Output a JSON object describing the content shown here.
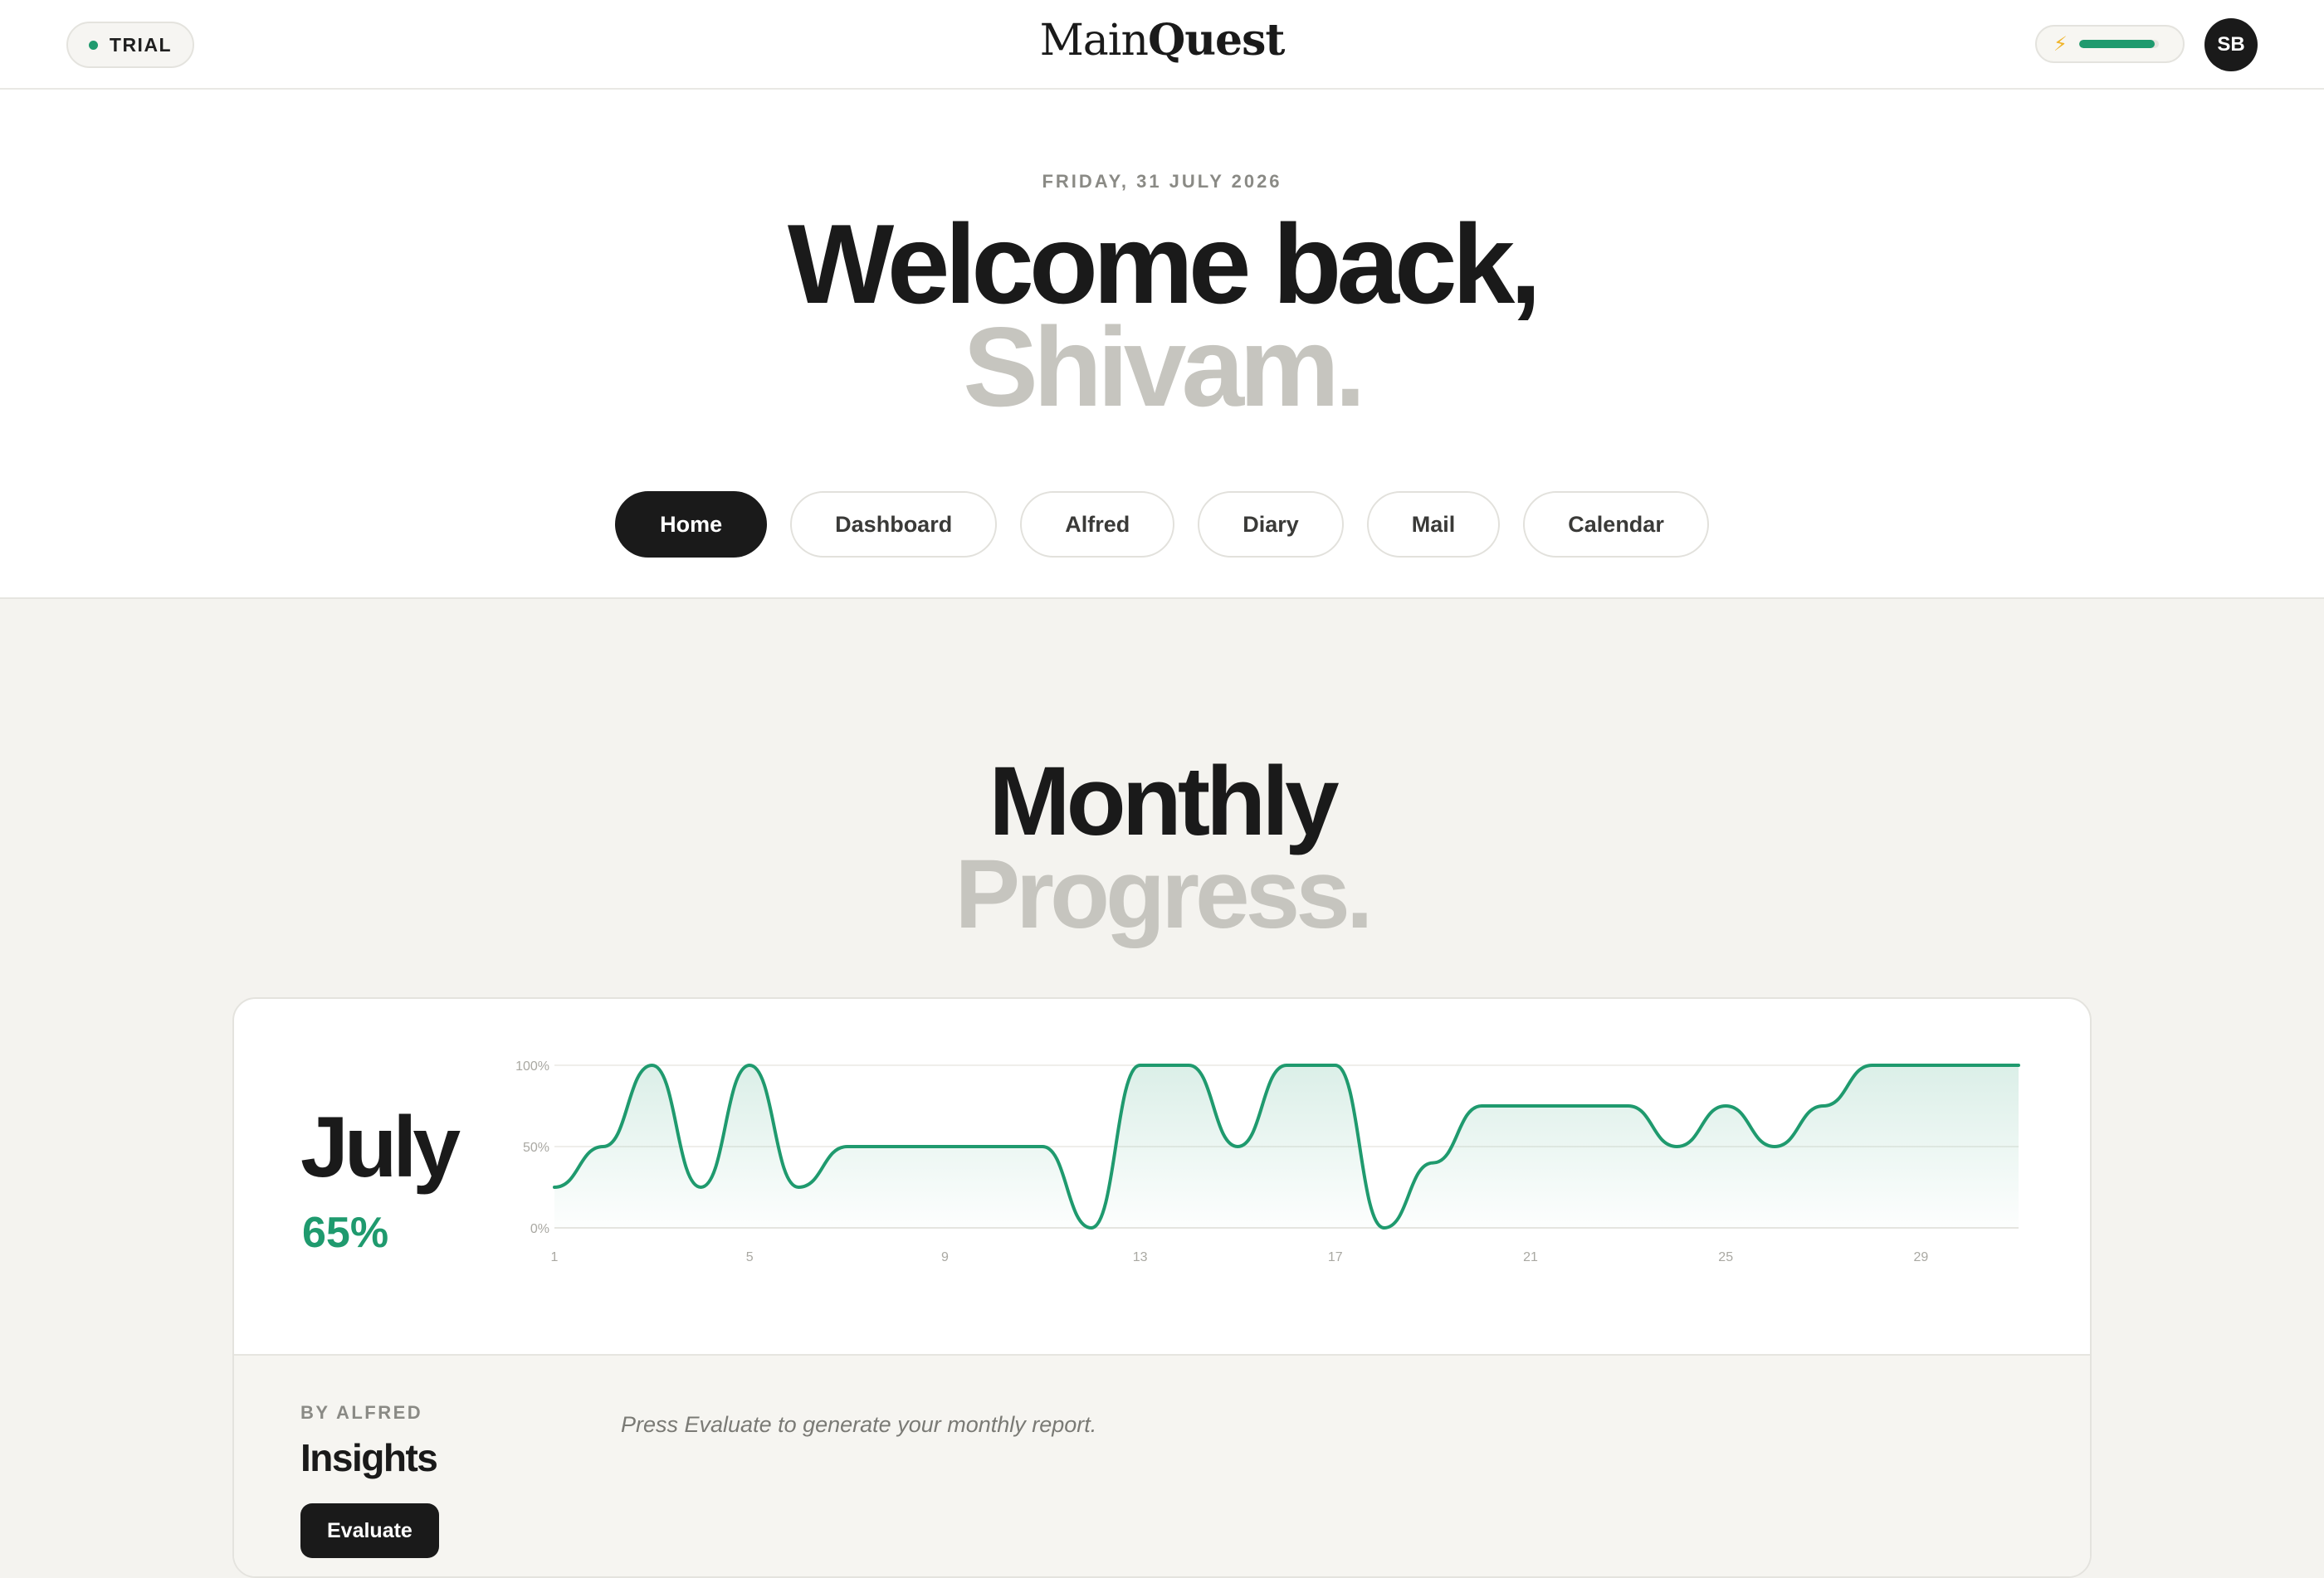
{
  "header": {
    "trial_label": "TRIAL",
    "brand_part1": "Main",
    "brand_part2": "Quest",
    "energy_icon": "bolt-icon",
    "energy_level": 0.95,
    "avatar_initials": "SB"
  },
  "hero": {
    "date": "FRIDAY, 31 JULY 2026",
    "welcome_line1": "Welcome back,",
    "welcome_line2": "Shivam."
  },
  "nav": {
    "items": [
      {
        "label": "Home",
        "active": true
      },
      {
        "label": "Dashboard",
        "active": false
      },
      {
        "label": "Alfred",
        "active": false
      },
      {
        "label": "Diary",
        "active": false
      },
      {
        "label": "Mail",
        "active": false
      },
      {
        "label": "Calendar",
        "active": false
      }
    ]
  },
  "section": {
    "title_line1": "Monthly",
    "title_line2": "Progress."
  },
  "progress_card": {
    "month": "July",
    "percent": "65%"
  },
  "insights": {
    "byline": "BY ALFRED",
    "title": "Insights",
    "evaluate_label": "Evaluate",
    "hint": "Press Evaluate to generate your monthly report."
  },
  "colors": {
    "accent_green": "#1f9a6e",
    "dark": "#1a1a1a",
    "muted_gray": "#c6c5bf",
    "background": "#f4f3ef"
  },
  "chart_data": {
    "type": "area",
    "x": [
      1,
      2,
      3,
      4,
      5,
      6,
      7,
      8,
      9,
      10,
      11,
      12,
      13,
      14,
      15,
      16,
      17,
      18,
      19,
      20,
      21,
      22,
      23,
      24,
      25,
      26,
      27,
      28,
      29,
      30,
      31
    ],
    "values": [
      25,
      50,
      100,
      25,
      100,
      25,
      50,
      50,
      50,
      50,
      50,
      0,
      100,
      100,
      50,
      100,
      100,
      0,
      40,
      75,
      75,
      75,
      75,
      50,
      75,
      50,
      75,
      100,
      100,
      100,
      100
    ],
    "xticks": [
      "1",
      "5",
      "9",
      "13",
      "17",
      "21",
      "25",
      "29"
    ],
    "yticks": [
      "0%",
      "50%",
      "100%"
    ],
    "ylim": [
      0,
      100
    ],
    "xlim": [
      1,
      31
    ],
    "grid": true,
    "color": "#1f9a6e"
  }
}
